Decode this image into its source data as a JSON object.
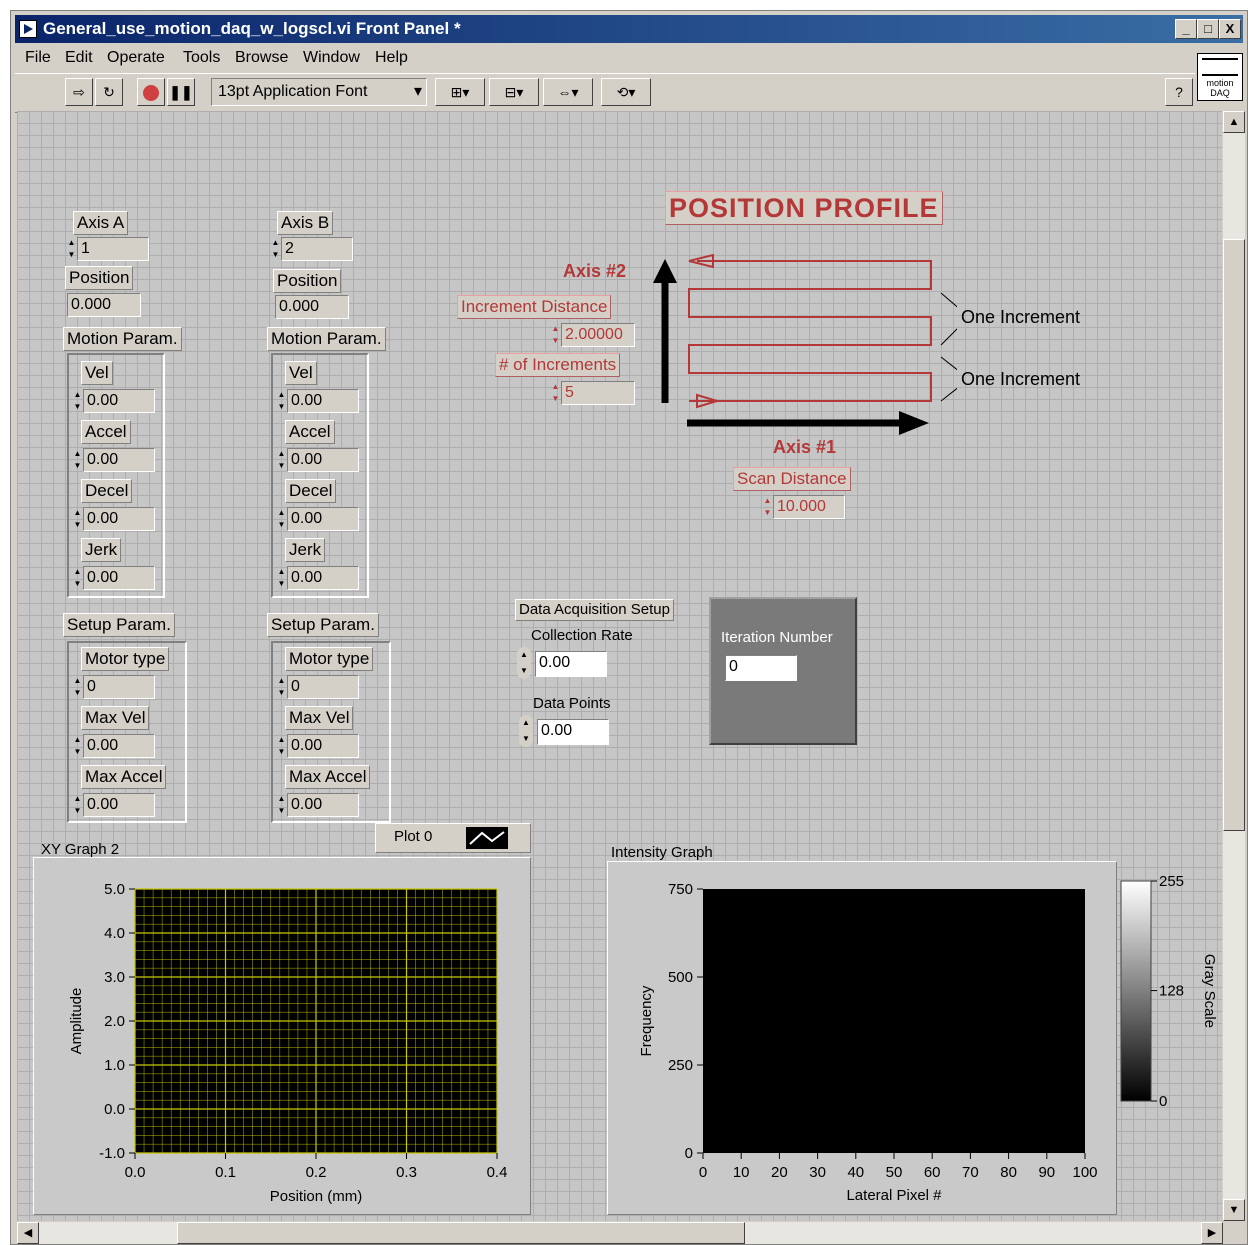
{
  "window": {
    "title": "General_use_motion_daq_w_logscl.vi Front Panel *",
    "minimize": "_",
    "maximize": "□",
    "close": "X"
  },
  "menu": [
    "File",
    "Edit",
    "Operate",
    "Tools",
    "Browse",
    "Window",
    "Help"
  ],
  "toolbar": {
    "font": "13pt Application Font",
    "help": "?",
    "vi_icon": "motion DAQ"
  },
  "axisA": {
    "label": "Axis A",
    "value": "1",
    "position_label": "Position",
    "position": "0.000",
    "motion_label": "Motion Param.",
    "motion": [
      {
        "label": "Vel",
        "value": "0.00"
      },
      {
        "label": "Accel",
        "value": "0.00"
      },
      {
        "label": "Decel",
        "value": "0.00"
      },
      {
        "label": "Jerk",
        "value": "0.00"
      }
    ],
    "setup_label": "Setup Param.",
    "setup": [
      {
        "label": "Motor type",
        "value": "0"
      },
      {
        "label": "Max Vel",
        "value": "0.00"
      },
      {
        "label": "Max Accel",
        "value": "0.00"
      }
    ]
  },
  "axisB": {
    "label": "Axis B",
    "value": "2",
    "position_label": "Position",
    "position": "0.000",
    "motion_label": "Motion Param.",
    "motion": [
      {
        "label": "Vel",
        "value": "0.00"
      },
      {
        "label": "Accel",
        "value": "0.00"
      },
      {
        "label": "Decel",
        "value": "0.00"
      },
      {
        "label": "Jerk",
        "value": "0.00"
      }
    ],
    "setup_label": "Setup Param.",
    "setup": [
      {
        "label": "Motor type",
        "value": "0"
      },
      {
        "label": "Max Vel",
        "value": "0.00"
      },
      {
        "label": "Max Accel",
        "value": "0.00"
      }
    ]
  },
  "profile": {
    "title": "POSITION PROFILE",
    "axis2": "Axis #2",
    "axis1": "Axis #1",
    "increment_label": "Increment Distance",
    "increment": "2.00000",
    "num_label": "# of Increments",
    "num": "5",
    "scan_label": "Scan Distance",
    "scan": "10.000",
    "one_increment": "One Increment"
  },
  "daq": {
    "label": "Data Acquisition Setup",
    "rate_label": "Collection Rate",
    "rate": "0.00",
    "points_label": "Data Points",
    "points": "0.00"
  },
  "iteration": {
    "label": "Iteration Number",
    "value": "0"
  },
  "xy_graph": {
    "title": "XY Graph 2",
    "plot_legend": "Plot 0",
    "xlabel": "Position (mm)",
    "ylabel": "Amplitude",
    "xticks": [
      "0.0",
      "0.1",
      "0.2",
      "0.3",
      "0.4"
    ],
    "yticks": [
      "5.0",
      "4.0",
      "3.0",
      "2.0",
      "1.0",
      "0.0",
      "-1.0"
    ],
    "grid_color": "#c8c800"
  },
  "intensity_graph": {
    "title": "Intensity Graph",
    "xlabel": "Lateral Pixel #",
    "ylabel": "Frequency",
    "xticks": [
      "0",
      "10",
      "20",
      "30",
      "40",
      "50",
      "60",
      "70",
      "80",
      "90",
      "100"
    ],
    "yticks": [
      "750",
      "500",
      "250",
      "0"
    ],
    "scale_label": "Gray Scale",
    "scale_ticks": [
      "255",
      "128",
      "0"
    ]
  },
  "chart_data": [
    {
      "type": "scatter",
      "title": "XY Graph 2",
      "xlabel": "Position (mm)",
      "ylabel": "Amplitude",
      "xlim": [
        0.0,
        0.4
      ],
      "ylim": [
        -1.0,
        5.0
      ],
      "series": [
        {
          "name": "Plot 0",
          "x": [],
          "y": []
        }
      ],
      "grid": true
    },
    {
      "type": "heatmap",
      "title": "Intensity Graph",
      "xlabel": "Lateral Pixel #",
      "ylabel": "Frequency",
      "xlim": [
        0,
        100
      ],
      "ylim": [
        0,
        750
      ],
      "colorbar": {
        "label": "Gray Scale",
        "range": [
          0,
          255
        ]
      },
      "values": []
    }
  ]
}
